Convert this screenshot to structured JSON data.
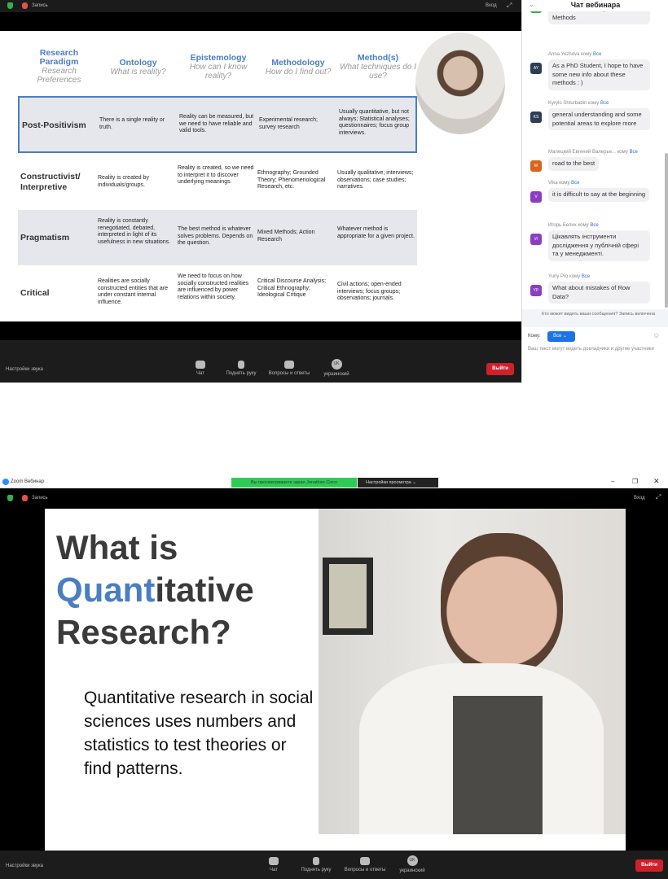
{
  "top": {
    "recording_label": "Запись",
    "enter_label": "Вход",
    "table": {
      "headers": [
        {
          "title": "Research Paradigm",
          "sub": "Research Preferences"
        },
        {
          "title": "Ontology",
          "sub": "What is reality?"
        },
        {
          "title": "Epistemology",
          "sub": "How can I know reality?"
        },
        {
          "title": "Methodology",
          "sub": "How do I find out?"
        },
        {
          "title": "Method(s)",
          "sub": "What techniques do I use?"
        }
      ],
      "rows": [
        {
          "name": "Post-Positivism",
          "cells": [
            "There is a single reality or truth.",
            "Reality can be measured, but we need to have reliable and valid tools.",
            "Experimental research; survey research",
            "Usually quantitative, but not always; Statistical analyses; questionnaires; focus group interviews."
          ]
        },
        {
          "name": "Constructivist/ Interpretive",
          "cells": [
            "Reality is created by individuals/groups.",
            "Reality is created, so we need to interpret it to discover underlying meanings.",
            "Ethnography; Grounded Theory; Phenomenological Research, etc.",
            "Usually qualitative; interviews; observations; case studies; narratives."
          ]
        },
        {
          "name": "Pragmatism",
          "cells": [
            "Reality is constantly renegotiated, debated, interpreted in light of its usefulness in new situations.",
            "The best method is whatever solves problems. Depends on the question.",
            "Mixed Methods; Action Research",
            "Whatever method is appropriate for a given project."
          ]
        },
        {
          "name": "Critical",
          "cells": [
            "Realities are socially constructed entities that are under constant internal influence.",
            "We need to focus on how socially constructed realities are influenced by power relations within society.",
            "Critical Discourse Analysis; Critical Ethnography; Ideological Critique",
            "Civil actions; open-ended interviews; focus groups; observations; journals."
          ]
        }
      ]
    },
    "toolbar": {
      "audio": "Настройки звука",
      "chat": "Чат",
      "raise_hand": "Поднять руку",
      "qa": "Вопросы и ответы",
      "lang_badge": "UK",
      "lang": "украинский",
      "leave": "Выйти"
    }
  },
  "chat": {
    "title": "Чат вебинара",
    "messages": [
      {
        "text": "Learn a basics of Quantitative Methods",
        "color": "#2fb34a",
        "initials": "НЯ"
      },
      {
        "sender": "Anna Yezhova",
        "to": "кому",
        "target": "Все",
        "initials": "AY",
        "color": "#2d3e55",
        "text": "As a PhD Student, I hope to have some new info about these methods : )"
      },
      {
        "sender": "Kyrylo Shturbabin",
        "to": "кому",
        "target": "Все",
        "initials": "KS",
        "color": "#2d3e55",
        "text": "general understanding and some potential areas to explore more"
      },
      {
        "sender": "Малецкий Евгений Валерье...",
        "to": "кому",
        "target": "Все",
        "initials": "М",
        "color": "#d9641e",
        "text": "road to the best"
      },
      {
        "sender": "Vika",
        "to": "кому",
        "target": "Все",
        "initials": "V",
        "color": "#8a3fc0",
        "text": "it is difficult to say at the beginning"
      },
      {
        "sender": "Игорь Белих",
        "to": "кому",
        "target": "Все",
        "initials": "И",
        "color": "#8a3fc0",
        "text": "Цікавлять інструменти дослідження у публічній сфері та у менеджменті."
      },
      {
        "sender": "Yuriy Pro",
        "to": "кому",
        "target": "Все",
        "initials": "YP",
        "color": "#8a3fc0",
        "text": "What about mistakes of Row Data?"
      }
    ],
    "visibility_note": "Кто может видеть ваши сообщения? Запись включена",
    "to_label": "Кому:",
    "to_value": "Все",
    "input_placeholder": "Ваш текст могут видеть докладчики и другие участники"
  },
  "bottom": {
    "app_title": "Zoom Вебинар",
    "viewing_banner": "Вы просматриваете экран Jonathan Cisco",
    "view_settings": "Настройки просмотра",
    "recording_label": "Запись",
    "enter_label": "Вход",
    "slide": {
      "title_line1": "What is",
      "title_highlight": "Quant",
      "title_rest": "itative",
      "title_line3": "Research?",
      "body": "Quantitative research in social sciences uses numbers and statistics to test theories or find patterns."
    },
    "toolbar": {
      "audio": "Настройки звука",
      "chat": "Чат",
      "raise_hand": "Поднять руку",
      "qa": "Вопросы и ответы",
      "lang_badge": "UK",
      "lang": "украинский",
      "leave": "Выйти"
    }
  }
}
